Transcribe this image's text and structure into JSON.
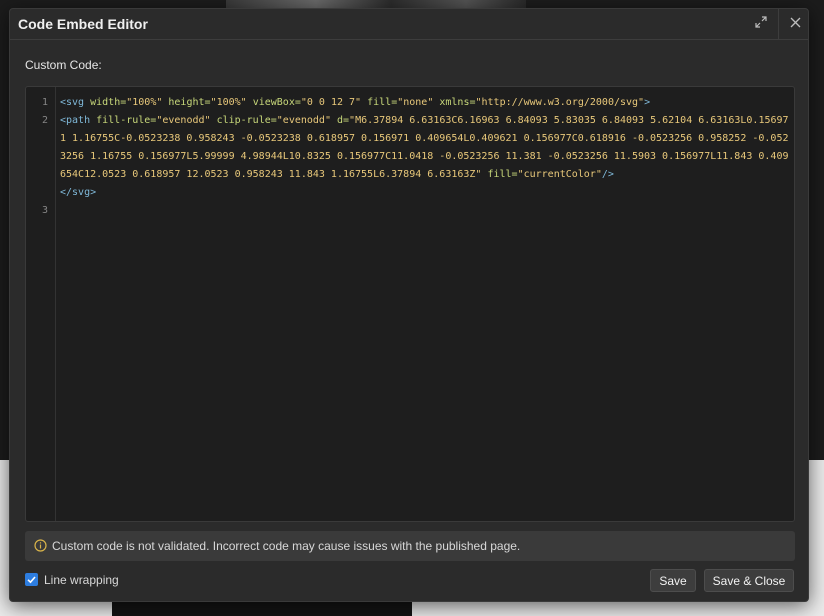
{
  "dialog": {
    "title": "Code Embed Editor",
    "section_label": "Custom Code:"
  },
  "editor": {
    "line_numbers": [
      "1",
      "2",
      "3"
    ],
    "lines": [
      [
        {
          "t": "tag",
          "v": "<svg "
        },
        {
          "t": "attr",
          "v": "width="
        },
        {
          "t": "val",
          "v": "\"100%\" "
        },
        {
          "t": "attr",
          "v": "height="
        },
        {
          "t": "val",
          "v": "\"100%\" "
        },
        {
          "t": "attr",
          "v": "viewBox="
        },
        {
          "t": "val",
          "v": "\"0 0 12 7\" "
        },
        {
          "t": "attr",
          "v": "fill="
        },
        {
          "t": "val",
          "v": "\"none\" "
        },
        {
          "t": "attr",
          "v": "xmlns="
        },
        {
          "t": "val",
          "v": "\"http://www.w3.org/2000/svg\""
        },
        {
          "t": "tag",
          "v": ">"
        }
      ],
      [
        {
          "t": "tag",
          "v": "<path "
        },
        {
          "t": "attr",
          "v": "fill-rule="
        },
        {
          "t": "val",
          "v": "\"evenodd\" "
        },
        {
          "t": "attr",
          "v": "clip-rule="
        },
        {
          "t": "val",
          "v": "\"evenodd\" "
        },
        {
          "t": "attr",
          "v": "d="
        },
        {
          "t": "val",
          "v": "\"M6.37894 6.63163C6.16963 6.84093 5.83035 6.84093 5.62104 6.63163L0.156971 1.16755C-0.0523238 0.958243 -0.0523238 0.618957 0.156971 0.409654L0.409621 0.156977C0.618916 -0.0523256 0.958252 -0.0523256 1.16755 0.156977L5.99999 4.98944L10.8325 0.156977C11.0418 -0.0523256 11.381 -0.0523256 11.5903 0.156977L11.843 0.409654C12.0523 0.618957 12.0523 0.958243 11.843 1.16755L6.37894 6.63163Z\" "
        },
        {
          "t": "attr",
          "v": "fill="
        },
        {
          "t": "val",
          "v": "\"currentColor\""
        },
        {
          "t": "tag",
          "v": "/>"
        }
      ],
      [
        {
          "t": "tag",
          "v": "</svg>"
        }
      ]
    ]
  },
  "notice": {
    "icon": "info-icon",
    "text": "Custom code is not validated. Incorrect code may cause issues with the published page."
  },
  "footer": {
    "line_wrapping_label": "Line wrapping",
    "line_wrapping_checked": true,
    "save_label": "Save",
    "save_close_label": "Save & Close"
  },
  "colors": {
    "accent": "#2d7de0",
    "tag": "#7fb8d8",
    "attr": "#c8d87a",
    "val": "#e8c87a"
  }
}
